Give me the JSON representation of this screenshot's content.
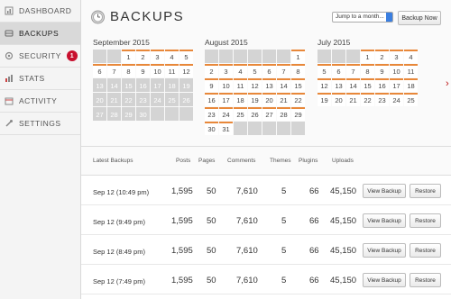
{
  "sidebar": {
    "items": [
      {
        "label": "DASHBOARD",
        "icon": "dashboard-icon",
        "active": false
      },
      {
        "label": "BACKUPS",
        "icon": "backups-icon",
        "active": true
      },
      {
        "label": "SECURITY",
        "icon": "security-icon",
        "active": false,
        "badge": "1"
      },
      {
        "label": "STATS",
        "icon": "stats-icon",
        "active": false
      },
      {
        "label": "ACTIVITY",
        "icon": "activity-icon",
        "active": false
      },
      {
        "label": "SETTINGS",
        "icon": "settings-icon",
        "active": false
      }
    ]
  },
  "header": {
    "title": "BACKUPS",
    "jump_select": "Jump to a month...",
    "backup_now": "Backup Now"
  },
  "calendars": [
    {
      "month": "September 2015",
      "days": [
        "",
        "",
        "1",
        "2",
        "3",
        "4",
        "5",
        "6",
        "7",
        "8",
        "9",
        "10",
        "11",
        "12",
        "13",
        "14",
        "15",
        "16",
        "17",
        "18",
        "19",
        "20",
        "21",
        "22",
        "23",
        "24",
        "25",
        "26",
        "27",
        "28",
        "29",
        "30",
        "",
        "",
        ""
      ],
      "backup_days": [
        "1",
        "2",
        "3",
        "4",
        "5",
        "6",
        "7",
        "8",
        "9",
        "10",
        "11",
        "12"
      ],
      "dim_days": [
        "13",
        "14",
        "15",
        "16",
        "17",
        "18",
        "19",
        "20",
        "21",
        "22",
        "23",
        "24",
        "25",
        "26",
        "27",
        "28",
        "29",
        "30"
      ]
    },
    {
      "month": "August 2015",
      "days": [
        "",
        "",
        "",
        "",
        "",
        "",
        "1",
        "2",
        "3",
        "4",
        "5",
        "6",
        "7",
        "8",
        "9",
        "10",
        "11",
        "12",
        "13",
        "14",
        "15",
        "16",
        "17",
        "18",
        "19",
        "20",
        "21",
        "22",
        "23",
        "24",
        "25",
        "26",
        "27",
        "28",
        "29",
        "30",
        "31",
        "",
        "",
        "",
        "",
        ""
      ],
      "backup_days": [
        "1",
        "2",
        "3",
        "4",
        "5",
        "6",
        "7",
        "8",
        "9",
        "10",
        "11",
        "12",
        "13",
        "14",
        "15",
        "16",
        "17",
        "18",
        "19",
        "20",
        "21",
        "22",
        "23",
        "24",
        "25",
        "26",
        "27",
        "28",
        "29",
        "30",
        "31"
      ],
      "dim_days": []
    },
    {
      "month": "July 2015",
      "days": [
        "",
        "",
        "",
        "1",
        "2",
        "3",
        "4",
        "5",
        "6",
        "7",
        "8",
        "9",
        "10",
        "11",
        "12",
        "13",
        "14",
        "15",
        "16",
        "17",
        "18",
        "19",
        "20",
        "21",
        "22",
        "23",
        "24",
        "25"
      ],
      "backup_days": [
        "1",
        "2",
        "3",
        "4",
        "5",
        "6",
        "7",
        "8",
        "9",
        "10",
        "11",
        "12",
        "13",
        "14",
        "15",
        "16",
        "17",
        "18",
        "19",
        "20",
        "21",
        "22",
        "23",
        "24",
        "25"
      ],
      "dim_days": []
    }
  ],
  "next_arrow": "›",
  "table": {
    "headers": {
      "latest": "Latest Backups",
      "posts": "Posts",
      "pages": "Pages",
      "comments": "Comments",
      "themes": "Themes",
      "plugins": "Plugins",
      "uploads": "Uploads"
    },
    "rows": [
      {
        "date": "Sep 12 (10:49 pm)",
        "posts": "1,595",
        "pages": "50",
        "comments": "7,610",
        "themes": "5",
        "plugins": "66",
        "uploads": "45,150",
        "view": "View Backup",
        "restore": "Restore"
      },
      {
        "date": "Sep 12 (9:49 pm)",
        "posts": "1,595",
        "pages": "50",
        "comments": "7,610",
        "themes": "5",
        "plugins": "66",
        "uploads": "45,150",
        "view": "View Backup",
        "restore": "Restore"
      },
      {
        "date": "Sep 12 (8:49 pm)",
        "posts": "1,595",
        "pages": "50",
        "comments": "7,610",
        "themes": "5",
        "plugins": "66",
        "uploads": "45,150",
        "view": "View Backup",
        "restore": "Restore"
      },
      {
        "date": "Sep 12 (7:49 pm)",
        "posts": "1,595",
        "pages": "50",
        "comments": "7,610",
        "themes": "5",
        "plugins": "66",
        "uploads": "45,150",
        "view": "View Backup",
        "restore": "Restore"
      }
    ]
  },
  "colors": {
    "accent": "#e8883a",
    "badge": "#c8102e",
    "select_arrow": "#3b7fe0"
  }
}
